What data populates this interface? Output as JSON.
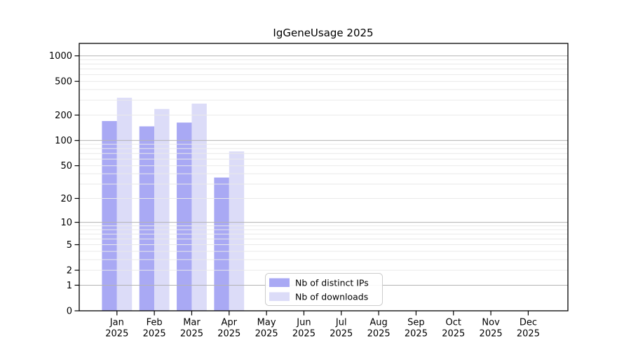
{
  "figure": {
    "background": "#ffffff"
  },
  "chart_data": {
    "type": "bar",
    "title": "IgGeneUsage 2025",
    "categories": [
      "Jan 2025",
      "Feb 2025",
      "Mar 2025",
      "Apr 2025",
      "May 2025",
      "Jun 2025",
      "Jul 2025",
      "Aug 2025",
      "Sep 2025",
      "Oct 2025",
      "Nov 2025",
      "Dec 2025"
    ],
    "series": [
      {
        "name": "Nb of distinct IPs",
        "color": "#a9a9f4",
        "values": [
          170,
          147,
          163,
          36,
          0,
          0,
          0,
          0,
          0,
          0,
          0,
          0
        ]
      },
      {
        "name": "Nb of downloads",
        "color": "#dcdcf8",
        "values": [
          320,
          236,
          273,
          74,
          0,
          0,
          0,
          0,
          0,
          0,
          0,
          0
        ]
      }
    ],
    "xlabel": "",
    "ylabel": "",
    "y_scale": "log10(value+1)",
    "y_ticks": [
      0,
      1,
      2,
      5,
      10,
      20,
      50,
      100,
      200,
      500,
      1000
    ],
    "y_major_gridlines": [
      1,
      10,
      100,
      1000
    ],
    "ylim": [
      0,
      1400
    ],
    "grid": true,
    "legend_position": "inside lower-center-left",
    "colors": {
      "grid_major": "#b3b3b3",
      "grid_minor": "#e9e9e9",
      "axis": "#000000"
    }
  }
}
